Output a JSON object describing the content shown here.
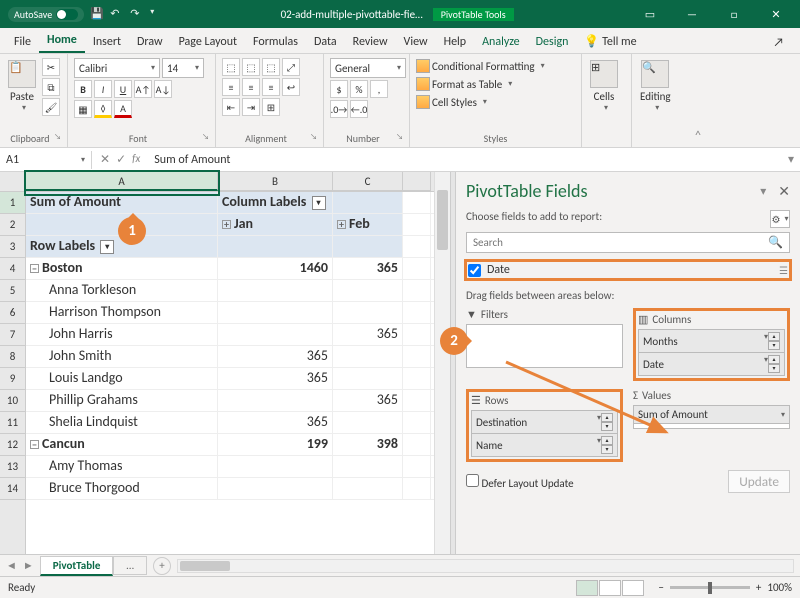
{
  "titlebar": {
    "autosave": "AutoSave",
    "filename": "02-add-multiple-pivottable-fie…",
    "tool_context": "PivotTable Tools"
  },
  "tabs": {
    "file": "File",
    "home": "Home",
    "insert": "Insert",
    "draw": "Draw",
    "page_layout": "Page Layout",
    "formulas": "Formulas",
    "data": "Data",
    "review": "Review",
    "view": "View",
    "help": "Help",
    "analyze": "Analyze",
    "design": "Design",
    "tell_me": "Tell me"
  },
  "ribbon": {
    "paste": "Paste",
    "font_name": "Calibri",
    "font_size": "14",
    "number_format": "General",
    "cond_fmt": "Conditional Formatting",
    "fmt_table": "Format as Table",
    "cell_styles": "Cell Styles",
    "cells": "Cells",
    "editing": "Editing",
    "groups": {
      "clipboard": "Clipboard",
      "font": "Font",
      "alignment": "Alignment",
      "number": "Number",
      "styles": "Styles"
    }
  },
  "namebox": "A1",
  "formula": "Sum of Amount",
  "columns": [
    "A",
    "B",
    "C"
  ],
  "rows": [
    {
      "a_class": "pvh bold",
      "a": "Sum of Amount",
      "b_class": "pvh bold",
      "b_pre": "",
      "b": "Column Labels",
      "b_fb": true,
      "c_class": "pvh",
      "c": ""
    },
    {
      "a_class": "pvh",
      "a": "",
      "b_class": "pvh bold",
      "b_pre": "+",
      "b": "Jan",
      "c_class": "pvh bold",
      "c_pre": "+",
      "c": "Feb"
    },
    {
      "a_class": "pvh bold",
      "a": "Row Labels",
      "a_fb": true,
      "b_class": "pvh",
      "b": "",
      "c_class": "pvh",
      "c": ""
    },
    {
      "a_class": "bold",
      "a_pre": "−",
      "a": "Boston",
      "b_class": "right bold",
      "b": "1460",
      "c_class": "right bold",
      "c": "365"
    },
    {
      "a": "      Anna Torkleson",
      "b": "",
      "c": ""
    },
    {
      "a": "      Harrison Thompson",
      "b": "",
      "c": ""
    },
    {
      "a": "      John Harris",
      "b_class": "right",
      "b": "",
      "c_class": "right",
      "c": "365"
    },
    {
      "a": "      John Smith",
      "b_class": "right",
      "b": "365",
      "c": ""
    },
    {
      "a": "      Louis Landgo",
      "b_class": "right",
      "b": "365",
      "c": ""
    },
    {
      "a": "      Phillip Grahams",
      "b": "",
      "c_class": "right",
      "c": "365"
    },
    {
      "a": "      Shelia Lindquist",
      "b_class": "right",
      "b": "365",
      "c": ""
    },
    {
      "a_class": "bold",
      "a_pre": "−",
      "a": "Cancun",
      "b_class": "right bold",
      "b": "199",
      "c_class": "right bold",
      "c": "398"
    },
    {
      "a": "      Amy Thomas",
      "b": "",
      "c": ""
    },
    {
      "a": "      Bruce Thorgood",
      "b": "",
      "c": ""
    }
  ],
  "pane": {
    "title": "PivotTable Fields",
    "choose": "Choose fields to add to report:",
    "search_ph": "Search",
    "field_date": "Date",
    "drag": "Drag fields between areas below:",
    "filters": "Filters",
    "columns": "Columns",
    "rows_": "Rows",
    "values": "Values",
    "col_chips": [
      "Months",
      "Date"
    ],
    "row_chips": [
      "Destination",
      "Name"
    ],
    "val_chips": [
      "Sum of Amount"
    ],
    "defer": "Defer Layout Update",
    "update": "Update"
  },
  "sheets": {
    "active": "PivotTable",
    "other": "…"
  },
  "status": {
    "ready": "Ready",
    "zoom": "100%"
  }
}
